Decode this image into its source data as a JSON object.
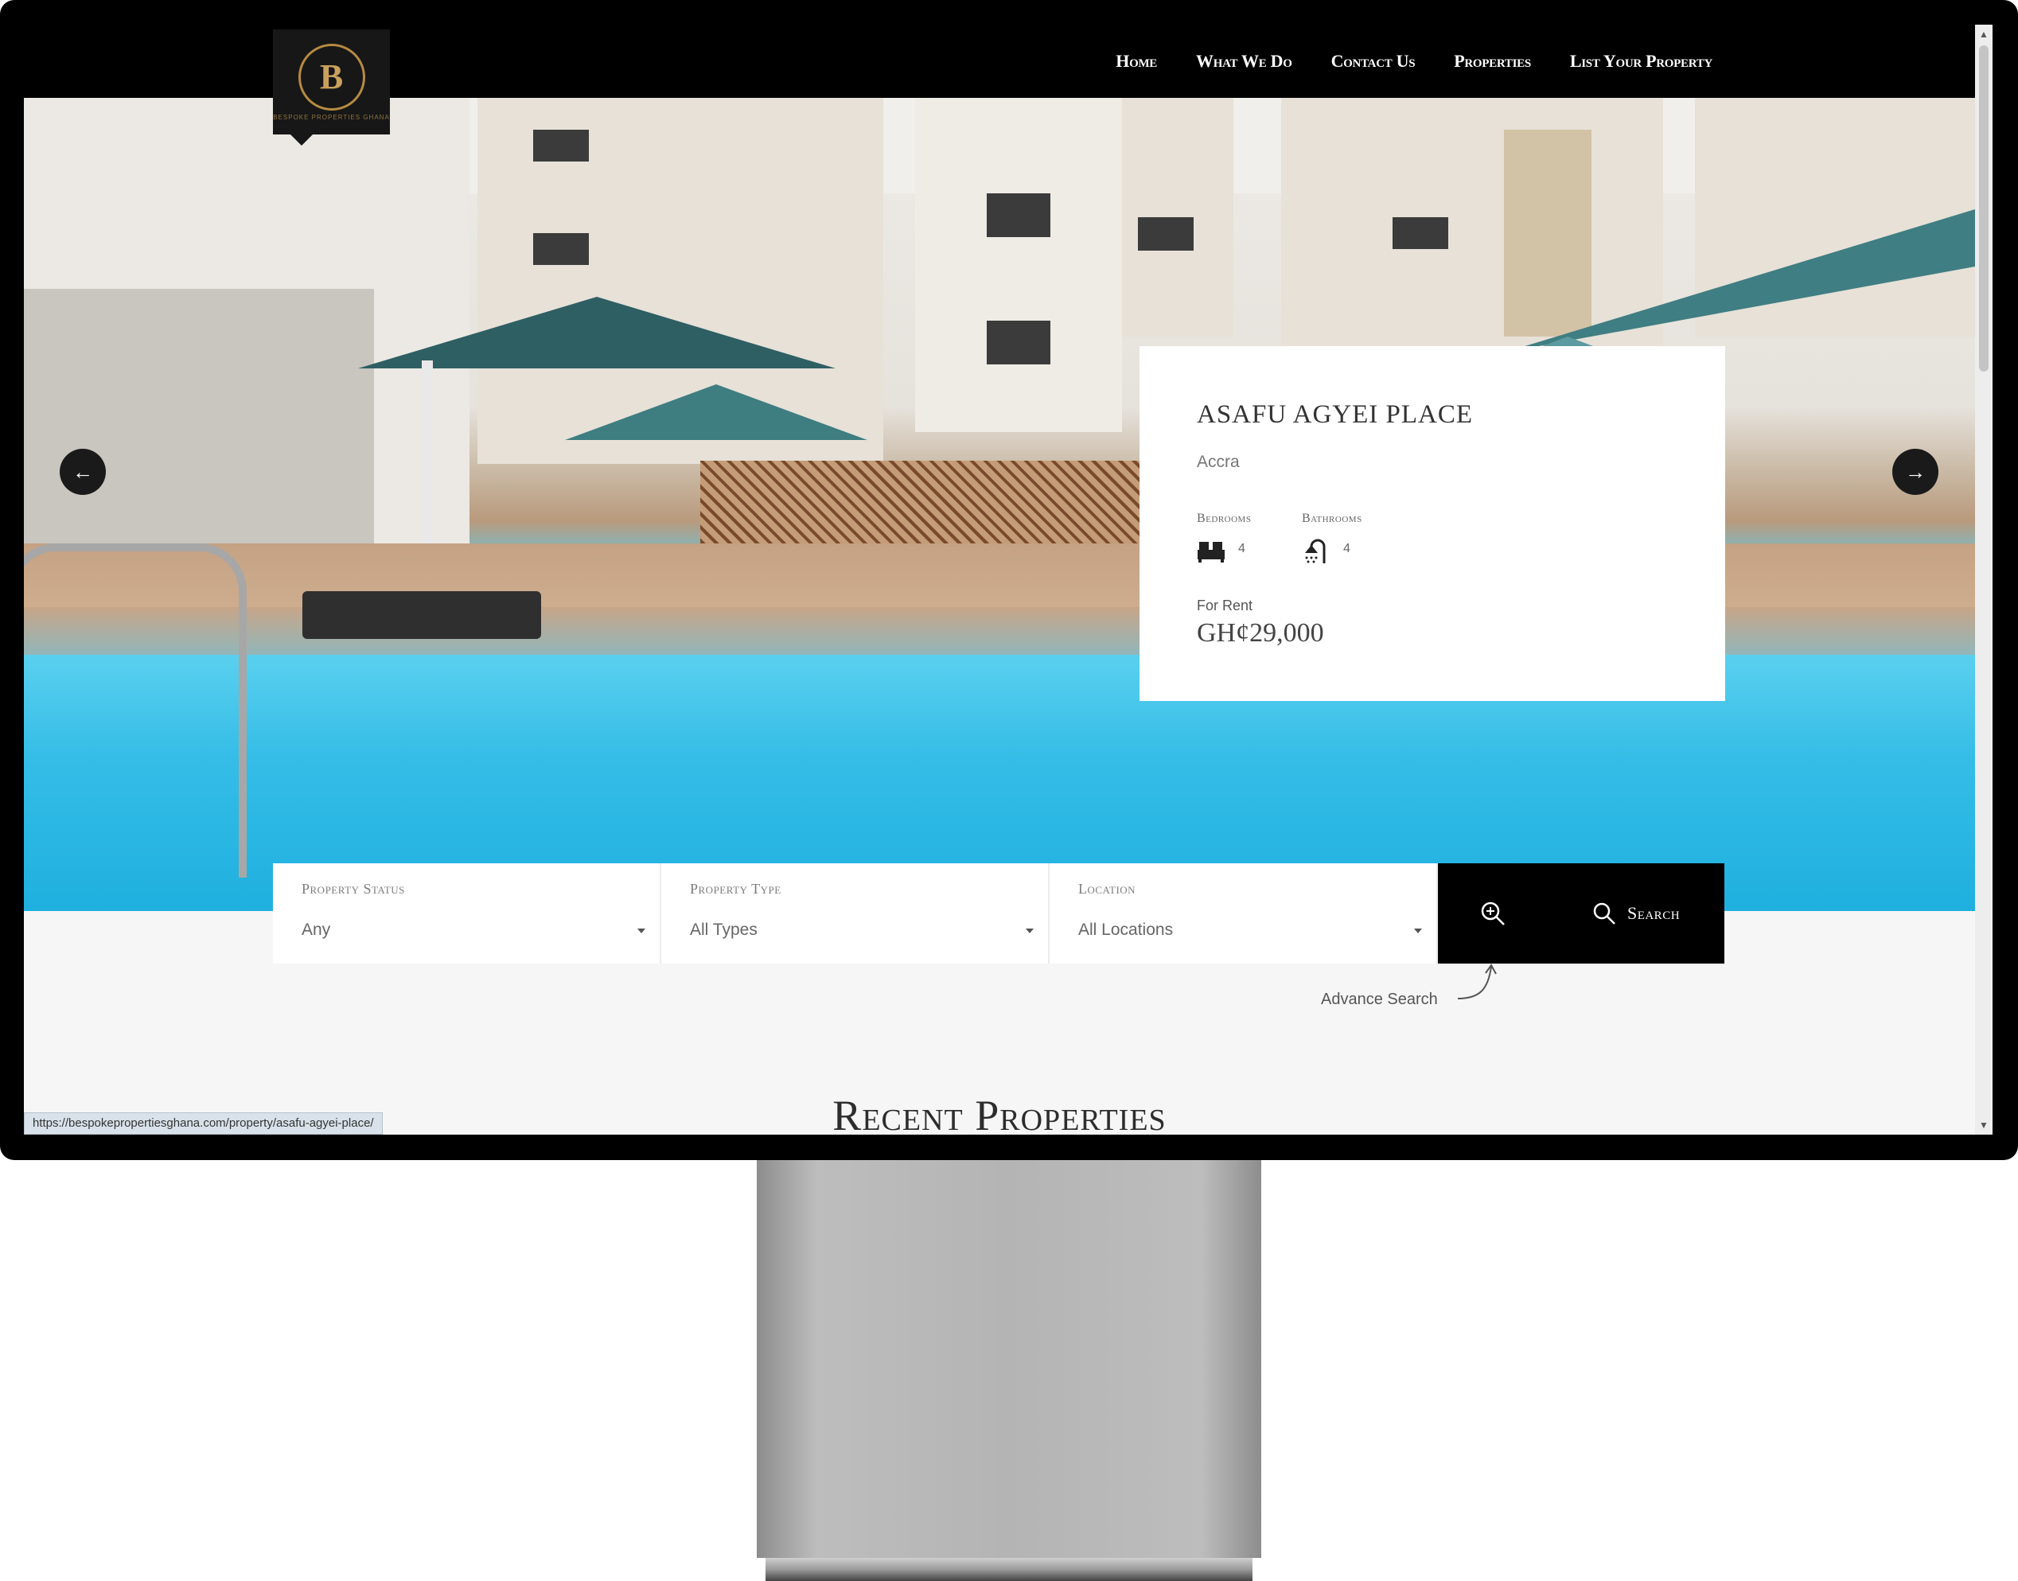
{
  "nav": {
    "logo_text": "BESPOKE PROPERTIES GHANA",
    "logo_letter": "B",
    "items": [
      "Home",
      "What We Do",
      "Contact Us",
      "Properties",
      "List Your Property"
    ]
  },
  "slider": {
    "prev_icon": "arrow-left-icon",
    "next_icon": "arrow-right-icon"
  },
  "property": {
    "title": "ASAFU AGYEI PLACE",
    "location": "Accra",
    "bedrooms_label": "Bedrooms",
    "bedrooms": "4",
    "bathrooms_label": "Bathrooms",
    "bathrooms": "4",
    "status": "For Rent",
    "price": "GH¢29,000"
  },
  "search": {
    "fields": [
      {
        "label": "Property Status",
        "value": "Any"
      },
      {
        "label": "Property Type",
        "value": "All Types"
      },
      {
        "label": "Location",
        "value": "All Locations"
      }
    ],
    "search_label": "Search",
    "advance_hint": "Advance Search"
  },
  "sections": {
    "recent_title": "Recent Properties"
  },
  "status_bar": {
    "url": "https://bespokepropertiesghana.com/property/asafu-agyei-place/"
  },
  "colors": {
    "navbar": "#000000",
    "accent_gold": "#b68a41",
    "pool_blue": "#35bde7"
  }
}
